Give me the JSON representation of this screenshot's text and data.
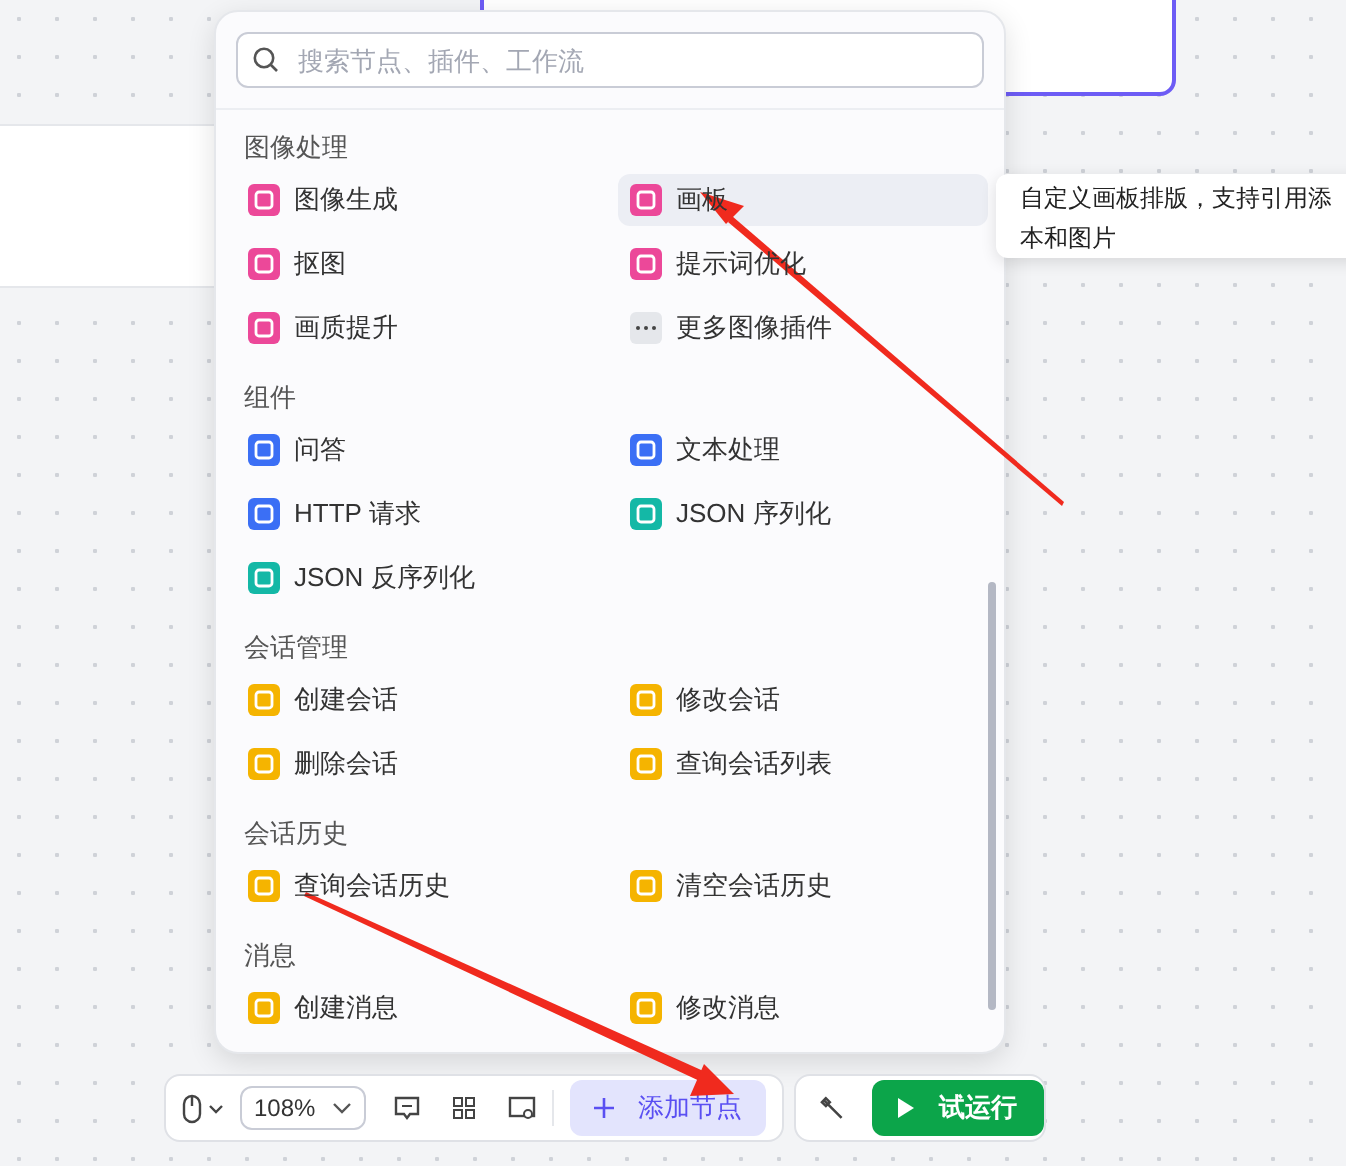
{
  "search": {
    "placeholder": "搜索节点、插件、工作流"
  },
  "sections": [
    {
      "title": "图像处理",
      "items": [
        {
          "label": "图像生成",
          "kind": "plugin",
          "color": "#ec4899",
          "hovered": false
        },
        {
          "label": "画板",
          "kind": "plugin",
          "color": "#ec4899",
          "hovered": true
        },
        {
          "label": "抠图",
          "kind": "plugin",
          "color": "#ec4899",
          "hovered": false
        },
        {
          "label": "提示词优化",
          "kind": "plugin",
          "color": "#ec4899",
          "hovered": false
        },
        {
          "label": "画质提升",
          "kind": "plugin",
          "color": "#ec4899",
          "hovered": false
        },
        {
          "label": "更多图像插件",
          "kind": "more",
          "color": "#e5e7eb",
          "hovered": false
        }
      ]
    },
    {
      "title": "组件",
      "items": [
        {
          "label": "问答",
          "kind": "plugin",
          "color": "#3b6ff5",
          "hovered": false
        },
        {
          "label": "文本处理",
          "kind": "plugin",
          "color": "#3b6ff5",
          "hovered": false
        },
        {
          "label": "HTTP 请求",
          "kind": "plugin",
          "color": "#3b6ff5",
          "hovered": false
        },
        {
          "label": "JSON 序列化",
          "kind": "plugin",
          "color": "#14b8a6",
          "hovered": false
        },
        {
          "label": "JSON 反序列化",
          "kind": "plugin",
          "color": "#14b8a6",
          "hovered": false
        }
      ]
    },
    {
      "title": "会话管理",
      "items": [
        {
          "label": "创建会话",
          "kind": "plugin",
          "color": "#f5b400",
          "hovered": false
        },
        {
          "label": "修改会话",
          "kind": "plugin",
          "color": "#f5b400",
          "hovered": false
        },
        {
          "label": "删除会话",
          "kind": "plugin",
          "color": "#f5b400",
          "hovered": false
        },
        {
          "label": "查询会话列表",
          "kind": "plugin",
          "color": "#f5b400",
          "hovered": false
        }
      ]
    },
    {
      "title": "会话历史",
      "items": [
        {
          "label": "查询会话历史",
          "kind": "plugin",
          "color": "#f5b400",
          "hovered": false
        },
        {
          "label": "清空会话历史",
          "kind": "plugin",
          "color": "#f5b400",
          "hovered": false
        }
      ]
    },
    {
      "title": "消息",
      "items": [
        {
          "label": "创建消息",
          "kind": "plugin",
          "color": "#f5b400",
          "hovered": false
        },
        {
          "label": "修改消息",
          "kind": "plugin",
          "color": "#f5b400",
          "hovered": false
        }
      ]
    }
  ],
  "tooltip": {
    "lines": [
      "自定义画板排版，支持引用添",
      "本和图片"
    ]
  },
  "toolbar": {
    "zoom": "108%",
    "add_node": "添加节点",
    "run": "试运行"
  }
}
